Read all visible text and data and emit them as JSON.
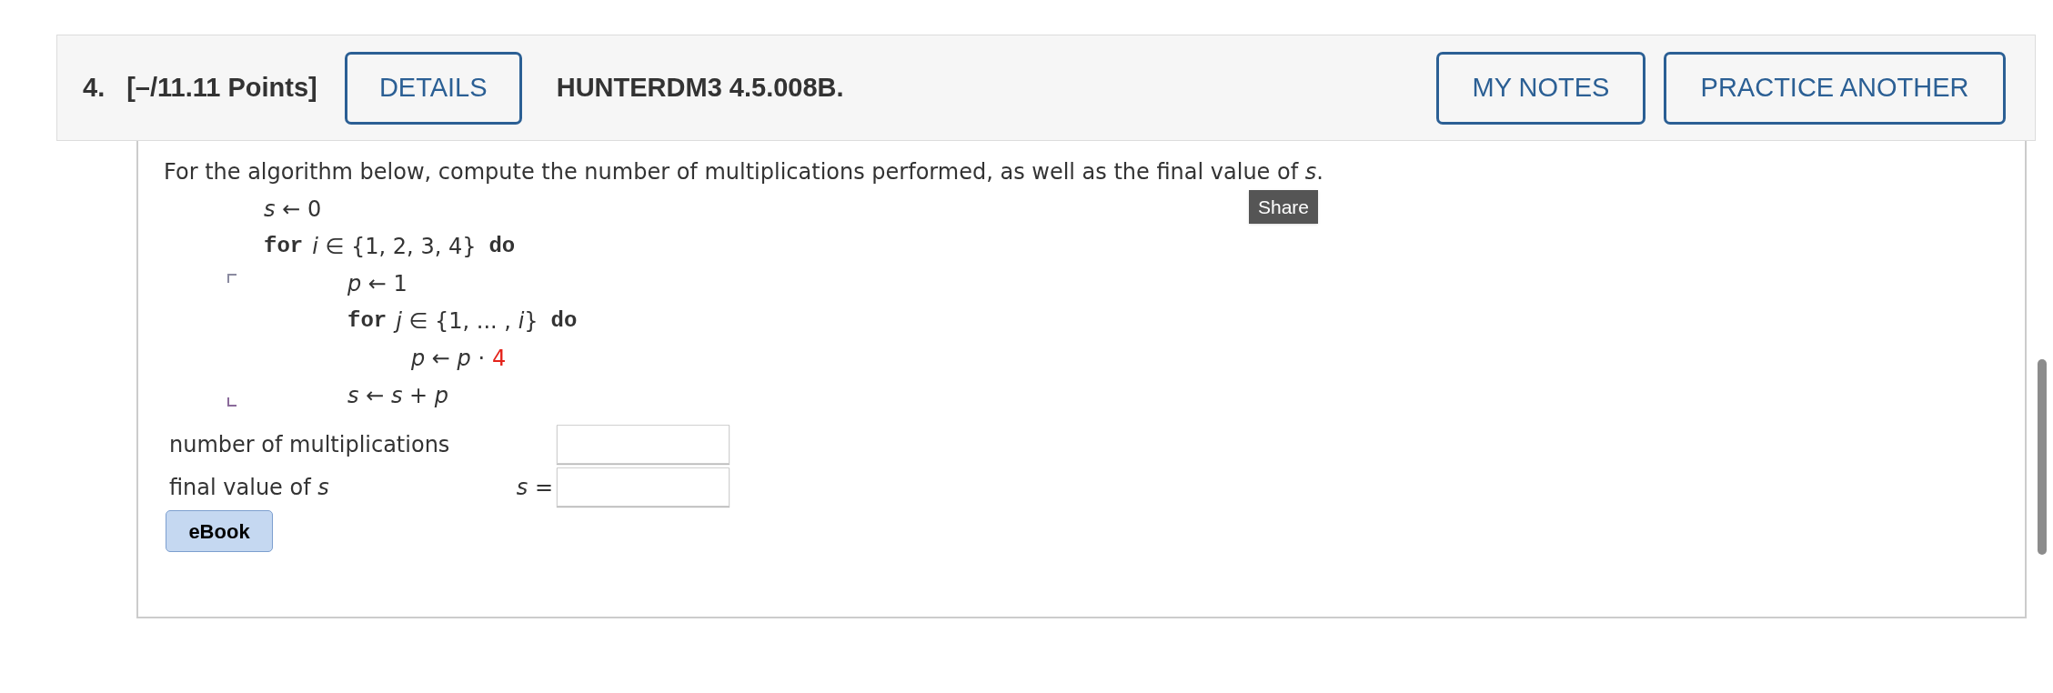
{
  "question": {
    "number": "4.",
    "points": "[–/11.11 Points]",
    "details_button": "DETAILS",
    "problem_code": "HUNTERDM3 4.5.008B.",
    "actions": [
      "MY NOTES",
      "PRACTICE ANOTHER"
    ]
  },
  "prompt": "For the algorithm below, compute the number of multiplications performed, as well as the final value of *s*.",
  "share_tooltip": "Share",
  "algorithm": [
    {
      "kind": "assign",
      "text": "*s* ← 0"
    },
    {
      "kind": "loop",
      "keyword": "for",
      "range": "*i* ∈ {1, 2, 3, 4}",
      "end_keyword": "do",
      "children": [
        {
          "kind": "assign",
          "text": "*p* ← 1"
        },
        {
          "kind": "loop",
          "keyword": "for",
          "range": "*j* ∈ {1, ... , *i*}",
          "end_keyword": "do",
          "children": [
            {
              "kind": "assign",
              "text": "*p* ← *p* ·",
              "parameter": "4",
              "highlighted": true
            }
          ]
        },
        {
          "kind": "assign",
          "text": "*s* ← *s* + *p*"
        }
      ]
    }
  ],
  "answers": [
    {
      "label": "number of multiplications"
    },
    {
      "label": "final value of *s*",
      "prefix": "*s* ="
    }
  ],
  "ebook_button": "eBook"
}
